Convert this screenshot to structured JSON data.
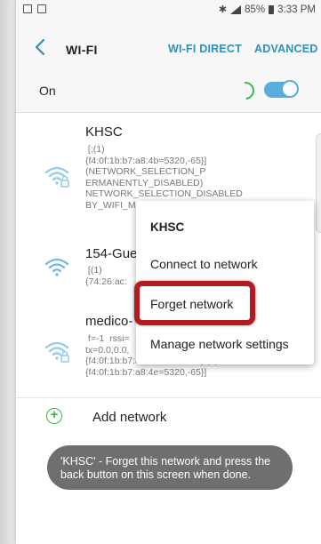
{
  "status_bar": {
    "battery": "85%",
    "time": "3:33 PM"
  },
  "app_bar": {
    "title": "WI-FI",
    "wifi_direct": "WI-FI DIRECT",
    "advanced": "ADVANCED"
  },
  "wifi_toggle": {
    "label": "On",
    "state": "on",
    "color": "#58aedb"
  },
  "networks": [
    {
      "name": "KHSC",
      "secured": true,
      "detail": " [;(1)\n{f4:0f:1b:b7:a8:4b=5320,-65}]\n(NETWORK_SELECTION_P\nERMANENTLY_DISABLED)\nNETWORK_SELECTION_DISABLED\nBY_WIFI_MANAGER"
    },
    {
      "name": "154-Guest",
      "secured": false,
      "detail": " [(1)\n{74:26:ac:"
    },
    {
      "name": "medico-",
      "secured": true,
      "detail": " f=-1  rssi=\ntx=0.0,0.0,\n{f4:0f:1b:b7:a8:41=2412,-71};(1)\n{f4:0f:1b:b7:a8:4e=5320,-65}]"
    }
  ],
  "add_network": "Add network",
  "popup": {
    "title": "KHSC",
    "options": [
      "Connect to network",
      "Forget network",
      "Manage network settings"
    ],
    "highlighted": "Forget network",
    "highlight_color": "#b01c22"
  },
  "toast": "'KHSC' - Forget this network and press the back button on this screen when done.",
  "colors": {
    "accent": "#2f8fbf",
    "wifi_icon": "#6cb8e0",
    "add_icon": "#3ab54a"
  }
}
